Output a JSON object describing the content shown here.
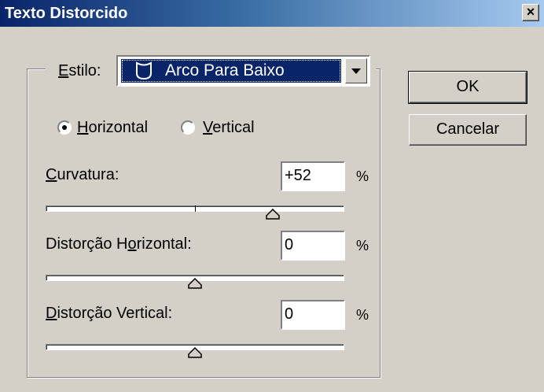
{
  "window": {
    "title": "Texto Distorcido",
    "close_glyph": "×"
  },
  "style": {
    "label": "Estilo:",
    "label_accel": "E",
    "selected": "Arco Para Baixo",
    "icon": "arc-lower-shape-icon"
  },
  "orientation": {
    "horizontal": {
      "label": "Horizontal",
      "checked": true
    },
    "vertical": {
      "label": "Vertical",
      "checked": false
    }
  },
  "bend": {
    "label": "Curvatura:",
    "value": "+52",
    "unit": "%",
    "slider_fraction": 0.76
  },
  "h_distortion": {
    "label": "Distorção Horizontal:",
    "value": "0",
    "unit": "%",
    "slider_fraction": 0.5
  },
  "v_distortion": {
    "label": "Distorção Vertical:",
    "value": "0",
    "unit": "%",
    "slider_fraction": 0.5
  },
  "buttons": {
    "ok": "OK",
    "cancel": "Cancelar"
  },
  "colors": {
    "titlebar_start": "#0a246a",
    "titlebar_end": "#a6caf0",
    "face": "#d4d0c8",
    "selection": "#0a246a"
  }
}
